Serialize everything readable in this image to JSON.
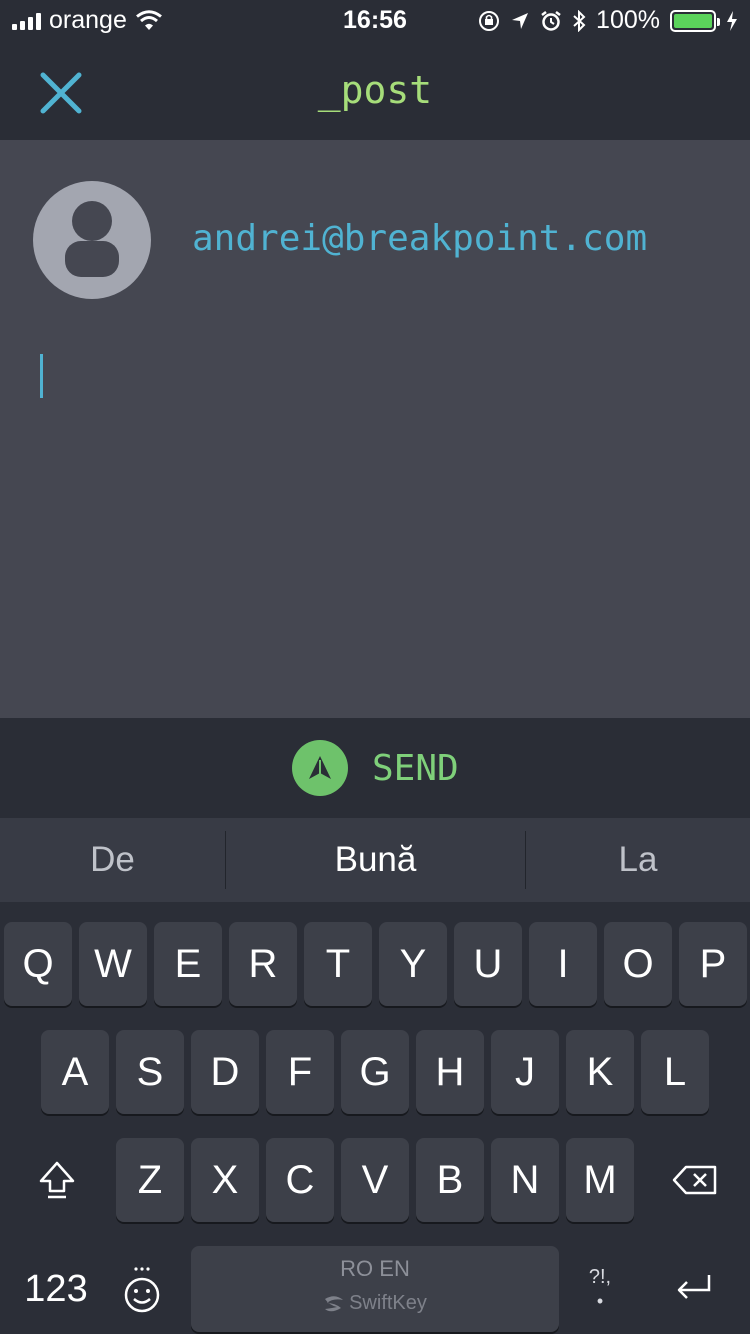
{
  "status_bar": {
    "carrier": "orange",
    "time": "16:56",
    "battery": "100%",
    "battery_color": "#5bd35b"
  },
  "nav": {
    "title": "_post",
    "title_color": "#a6dd7a",
    "close_icon": "close-icon"
  },
  "compose": {
    "email": "andrei@breakpoint.com",
    "message_value": "",
    "accent_color": "#50b3d2"
  },
  "send": {
    "label": "SEND",
    "color": "#6ec26b"
  },
  "suggestions": [
    "De",
    "Bună",
    "La"
  ],
  "keyboard": {
    "row1": [
      "Q",
      "W",
      "E",
      "R",
      "T",
      "Y",
      "U",
      "I",
      "O",
      "P"
    ],
    "row2": [
      "A",
      "S",
      "D",
      "F",
      "G",
      "H",
      "J",
      "K",
      "L"
    ],
    "row3": [
      "Z",
      "X",
      "C",
      "V",
      "B",
      "N",
      "M"
    ],
    "numbers_label": "123",
    "space_languages": "RO EN",
    "space_brand": "SwiftKey",
    "punctuation_label": "?!,",
    "punctuation_dot": "•"
  }
}
